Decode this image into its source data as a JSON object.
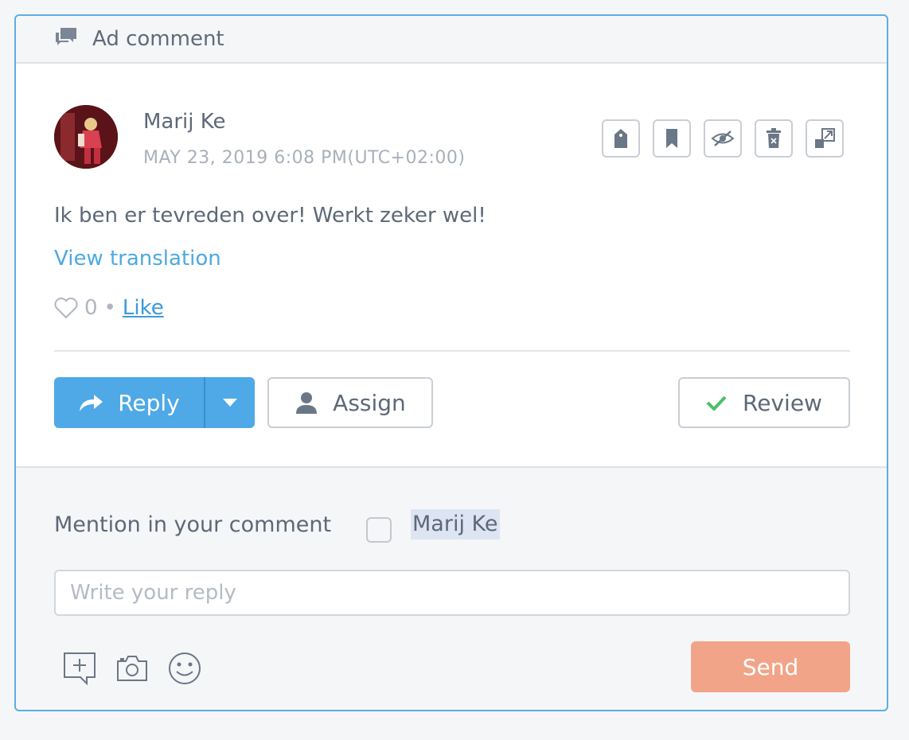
{
  "header": {
    "title": "Ad comment",
    "icon": "chat-bubbles-icon"
  },
  "comment": {
    "author": "Marij Ke",
    "timestamp": "MAY 23, 2019 6:08 PM(UTC+02:00)",
    "text": "Ik ben er tevreden over! Werkt zeker wel!",
    "view_translation": "View translation",
    "like_count": "0",
    "like_separator": "•",
    "like_label": "Like",
    "actions": [
      "tag-icon",
      "bookmark-icon",
      "hide-icon",
      "delete-icon",
      "expand-icon"
    ]
  },
  "buttons": {
    "reply": "Reply",
    "assign": "Assign",
    "review": "Review",
    "send": "Send"
  },
  "mention": {
    "label": "Mention in your comment",
    "name": "Marij Ke",
    "checked": false
  },
  "reply_input": {
    "placeholder": "Write your reply",
    "value": ""
  },
  "tools": [
    "add-comment-icon",
    "camera-icon",
    "emoji-icon"
  ],
  "colors": {
    "accent": "#4ea9e6",
    "send": "#f2a489",
    "review_check": "#4cbf6b",
    "border": "#5aaee3"
  }
}
